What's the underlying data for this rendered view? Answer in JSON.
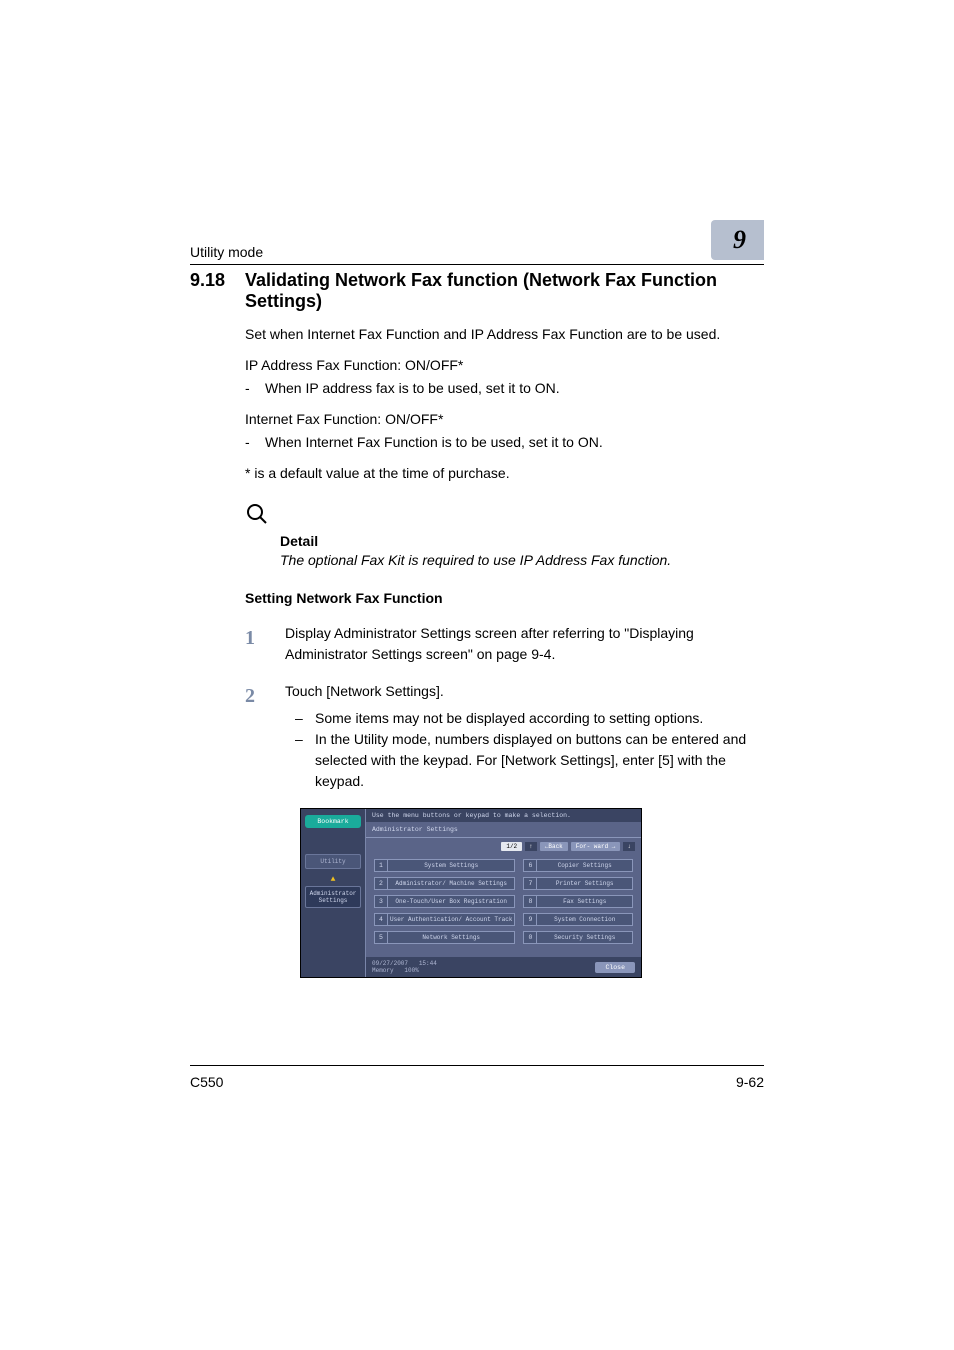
{
  "header": {
    "left": "Utility mode",
    "chapter": "9"
  },
  "section": {
    "number": "9.18",
    "title": "Validating Network Fax function (Network Fax Function Settings)"
  },
  "para1": "Set when Internet Fax Function and IP Address Fax Function are to be used.",
  "ip_line": "IP Address Fax Function: ON/OFF*",
  "ip_bullet": "When IP address fax is to be used, set it to ON.",
  "inet_line": "Internet Fax Function: ON/OFF*",
  "inet_bullet": "When Internet Fax Function is to be used, set it to ON.",
  "default_note": "* is a default value at the time of purchase.",
  "detail": {
    "head": "Detail",
    "body": "The optional Fax Kit is required to use IP Address Fax function."
  },
  "subhead": "Setting Network Fax Function",
  "steps": [
    {
      "num": "1",
      "text": "Display Administrator Settings screen after referring to \"Displaying Administrator Settings screen\" on page 9-4."
    },
    {
      "num": "2",
      "text": "Touch [Network Settings].",
      "subs": [
        "Some items may not be displayed according to setting options.",
        "In the Utility mode, numbers displayed on buttons can be entered and selected with the keypad. For [Network Settings], enter [5] with the keypad."
      ]
    }
  ],
  "device": {
    "top_instruction": "Use the menu buttons or keypad to make a selection.",
    "bookmark": "Bookmark",
    "side_utility": "Utility",
    "side_admin": "Administrator Settings",
    "main_head": "Administrator Settings",
    "page": "1/2",
    "back": "←Back",
    "forward": "For-\nward →",
    "left_items": [
      {
        "n": "1",
        "l": "System Settings"
      },
      {
        "n": "2",
        "l": "Administrator/\nMachine Settings"
      },
      {
        "n": "3",
        "l": "One-Touch/User Box\nRegistration"
      },
      {
        "n": "4",
        "l": "User Authentication/\nAccount Track"
      },
      {
        "n": "5",
        "l": "Network Settings"
      }
    ],
    "right_items": [
      {
        "n": "6",
        "l": "Copier Settings"
      },
      {
        "n": "7",
        "l": "Printer Settings"
      },
      {
        "n": "8",
        "l": "Fax Settings"
      },
      {
        "n": "9",
        "l": "System Connection"
      },
      {
        "n": "0",
        "l": "Security Settings"
      }
    ],
    "footer_date": "09/27/2007",
    "footer_time": "15:44",
    "footer_mem_label": "Memory",
    "footer_mem_val": "100%",
    "close": "Close"
  },
  "footer": {
    "left": "C550",
    "right": "9-62"
  }
}
